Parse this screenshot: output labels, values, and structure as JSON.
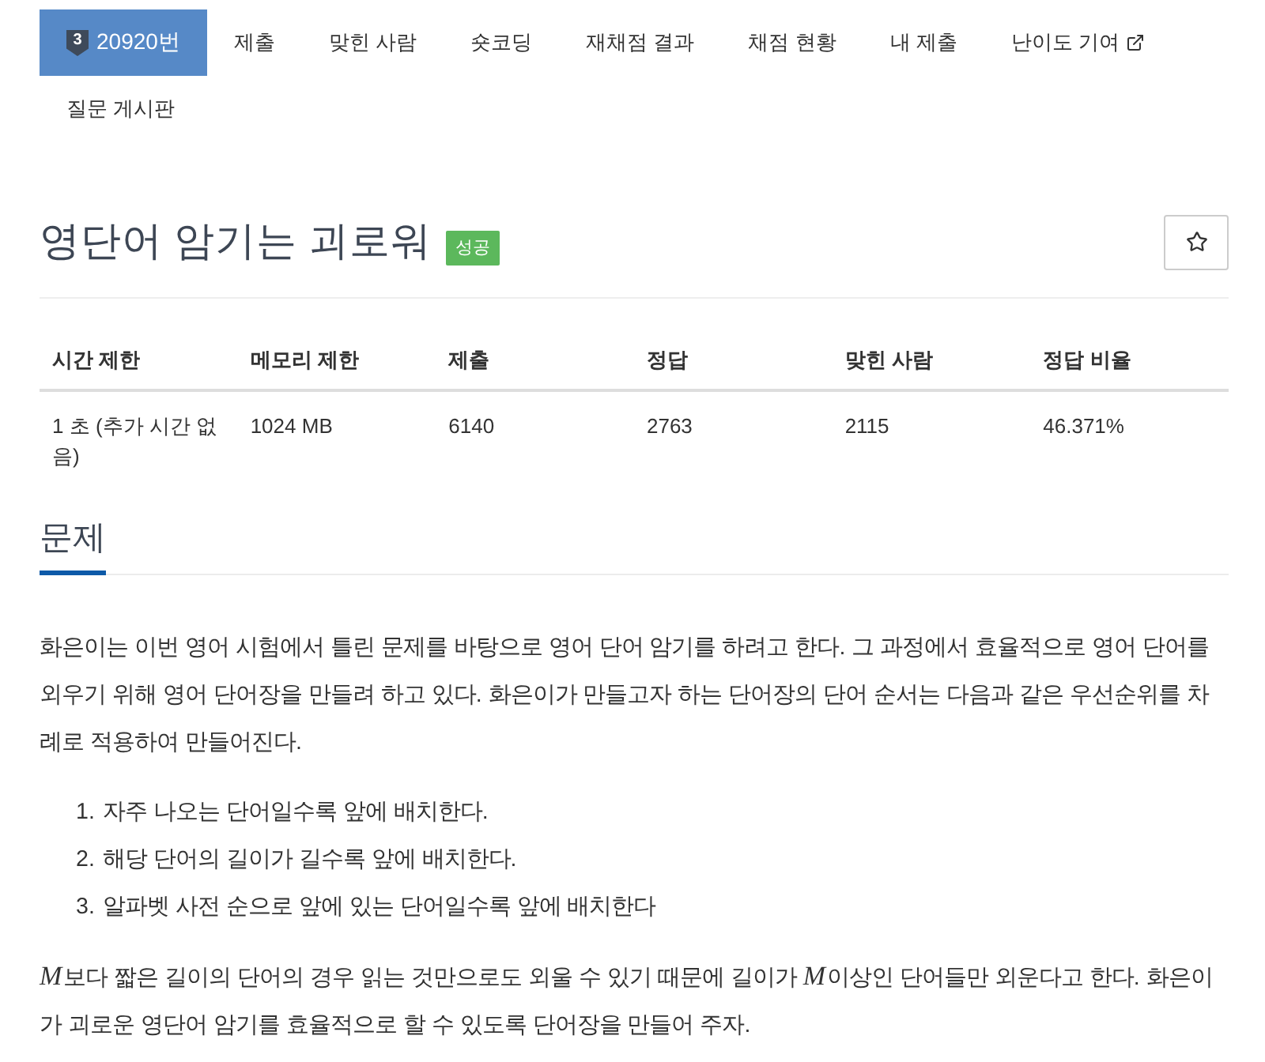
{
  "nav": {
    "tabs": [
      {
        "kind": "problem",
        "tier": "3",
        "label": "20920번",
        "selected": true
      },
      {
        "kind": "link",
        "label": "제출",
        "selected": false
      },
      {
        "kind": "link",
        "label": "맞힌 사람",
        "selected": false
      },
      {
        "kind": "link",
        "label": "숏코딩",
        "selected": false
      },
      {
        "kind": "link",
        "label": "재채점 결과",
        "selected": false
      },
      {
        "kind": "link",
        "label": "채점 현황",
        "selected": false
      },
      {
        "kind": "link",
        "label": "내 제출",
        "selected": false
      },
      {
        "kind": "external",
        "label": "난이도 기여",
        "selected": false
      },
      {
        "kind": "link",
        "label": "질문 게시판",
        "selected": false
      }
    ]
  },
  "header": {
    "title": "영단어 암기는 괴로워",
    "status_badge": "성공"
  },
  "info_table": {
    "columns": [
      "시간 제한",
      "메모리 제한",
      "제출",
      "정답",
      "맞힌 사람",
      "정답 비율"
    ],
    "rows": [
      [
        "1 초 (추가 시간 없음)",
        "1024 MB",
        "6140",
        "2763",
        "2115",
        "46.371%"
      ]
    ]
  },
  "problem": {
    "heading": "문제",
    "body": [
      {
        "kind": "paragraph",
        "parts": [
          {
            "kind": "text",
            "text": "화은이는 이번 영어 시험에서 틀린 문제를 바탕으로 영어 단어 암기를 하려고 한다. 그 과정에서 효율적으로 영어 단어를 외우기 위해 영어 단어장을 만들려 하고 있다. 화은이가 만들고자 하는 단어장의 단어 순서는 다음과 같은 우선순위를 차례로 적용하여 만들어진다."
          }
        ]
      },
      {
        "kind": "list",
        "items": [
          {
            "number": "1.",
            "text": "자주 나오는 단어일수록 앞에 배치한다."
          },
          {
            "number": "2.",
            "text": "해당 단어의 길이가 길수록 앞에 배치한다."
          },
          {
            "number": "3.",
            "text": "알파벳 사전 순으로 앞에 있는 단어일수록 앞에 배치한다"
          }
        ]
      },
      {
        "kind": "paragraph",
        "parts": [
          {
            "kind": "math",
            "text": "M"
          },
          {
            "kind": "text",
            "text": "보다 짧은 길이의 단어의 경우 읽는 것만으로도 외울 수 있기 때문에 길이가 "
          },
          {
            "kind": "math",
            "text": "M"
          },
          {
            "kind": "text",
            "text": "이상인 단어들만 외운다고 한다. 화은이가 괴로운 영단어 암기를 효율적으로 할 수 있도록 단어장을 만들어 주자."
          }
        ]
      }
    ]
  }
}
